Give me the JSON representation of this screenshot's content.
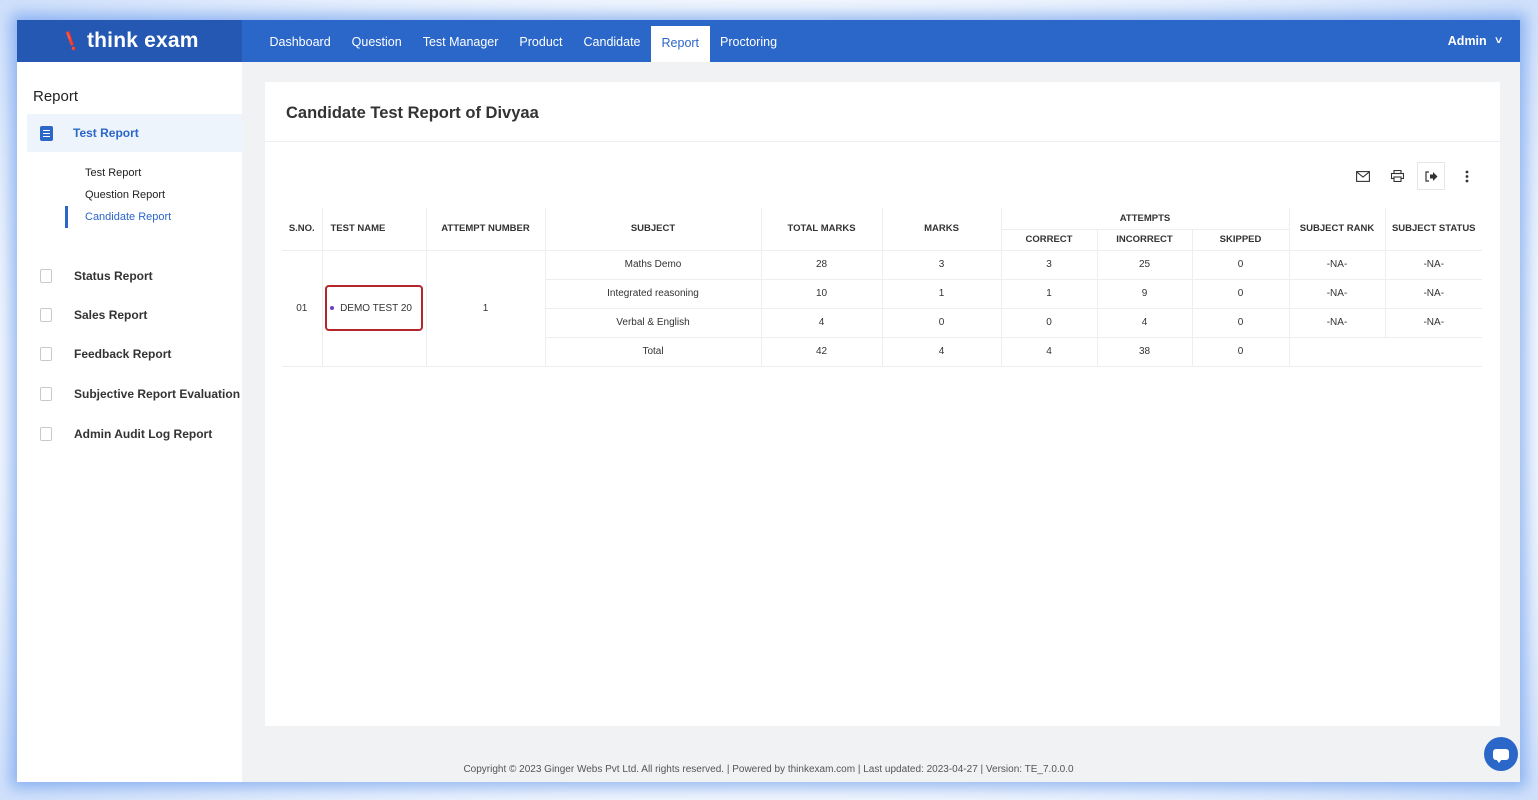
{
  "brand": {
    "logo_text": "think exam"
  },
  "nav": {
    "items": [
      {
        "label": "Dashboard"
      },
      {
        "label": "Question"
      },
      {
        "label": "Test Manager"
      },
      {
        "label": "Product"
      },
      {
        "label": "Candidate"
      },
      {
        "label": "Report",
        "active": true
      },
      {
        "label": "Proctoring"
      }
    ],
    "user_label": "Admin"
  },
  "sidebar": {
    "title": "Report",
    "active_section": "Test Report",
    "sub_items": [
      {
        "label": "Test Report"
      },
      {
        "label": "Question Report"
      },
      {
        "label": "Candidate Report",
        "active": true
      }
    ],
    "items": [
      {
        "label": "Status Report",
        "icon": "clipboard-icon"
      },
      {
        "label": "Sales Report",
        "icon": "chart-icon"
      },
      {
        "label": "Feedback Report",
        "icon": "clipboard-icon"
      },
      {
        "label": "Subjective Report Evaluation",
        "icon": "edit-icon"
      },
      {
        "label": "Admin Audit Log Report",
        "icon": "clipboard-icon"
      }
    ]
  },
  "main": {
    "title": "Candidate Test Report of Divyaa",
    "table": {
      "headers": {
        "sno": "S.NO.",
        "test_name": "TEST NAME",
        "attempt_number": "ATTEMPT NUMBER",
        "subject": "SUBJECT",
        "total_marks": "TOTAL MARKS",
        "marks": "MARKS",
        "attempts": "ATTEMPTS",
        "correct": "CORRECT",
        "incorrect": "INCORRECT",
        "skipped": "SKIPPED",
        "subject_rank": "SUBJECT RANK",
        "subject_status": "SUBJECT STATUS"
      },
      "row": {
        "sno": "01",
        "test_name": "DEMO TEST 20",
        "attempt_number": "1",
        "subjects": [
          {
            "subject": "Maths Demo",
            "total_marks": "28",
            "marks": "3",
            "correct": "3",
            "incorrect": "25",
            "skipped": "0",
            "rank": "-NA-",
            "status": "-NA-"
          },
          {
            "subject": "Integrated reasoning",
            "total_marks": "10",
            "marks": "1",
            "correct": "1",
            "incorrect": "9",
            "skipped": "0",
            "rank": "-NA-",
            "status": "-NA-"
          },
          {
            "subject": "Verbal & English",
            "total_marks": "4",
            "marks": "0",
            "correct": "0",
            "incorrect": "4",
            "skipped": "0",
            "rank": "-NA-",
            "status": "-NA-"
          }
        ],
        "total": {
          "subject": "Total",
          "total_marks": "42",
          "marks": "4",
          "correct": "4",
          "incorrect": "38",
          "skipped": "0"
        }
      }
    }
  },
  "footer": {
    "text": "Copyright © 2023 Ginger Webs Pvt Ltd. All rights reserved.  |  Powered by thinkexam.com  |  Last updated: 2023-04-27  |  Version: TE_7.0.0.0"
  },
  "colors": {
    "primary": "#2b66c9",
    "highlight_border": "#b3262a"
  }
}
